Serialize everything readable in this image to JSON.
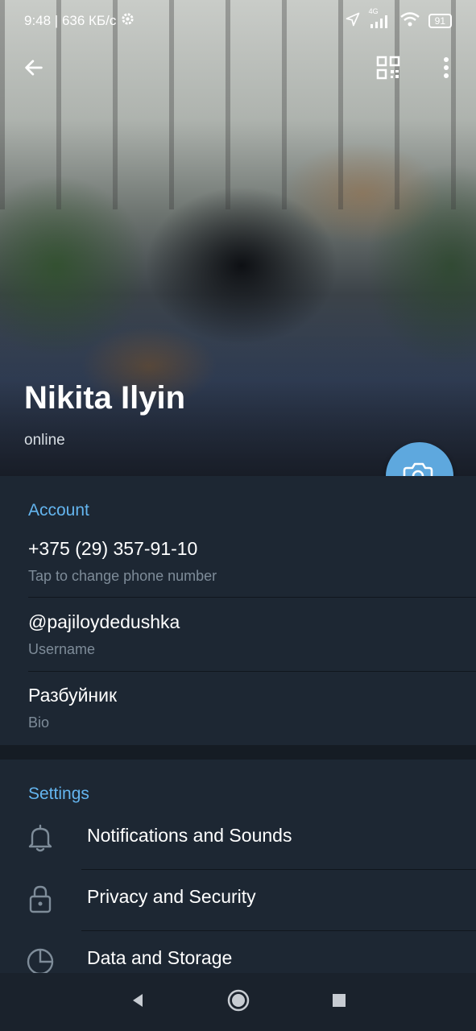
{
  "status_bar": {
    "time": "9:48 | 636 КБ/с",
    "network": "4G",
    "battery": "91"
  },
  "header": {
    "name": "Nikita Ilyin",
    "status": "online"
  },
  "account": {
    "title": "Account",
    "phone": "+375 (29) 357-91-10",
    "phone_hint": "Tap to change phone number",
    "username": "@pajiloydedushka",
    "username_label": "Username",
    "bio": "Разбуйник",
    "bio_label": "Bio"
  },
  "settings": {
    "title": "Settings",
    "items": [
      {
        "label": "Notifications and Sounds",
        "icon": "bell-icon"
      },
      {
        "label": "Privacy and Security",
        "icon": "lock-icon"
      },
      {
        "label": "Data and Storage",
        "icon": "pie-chart-icon"
      }
    ]
  },
  "colors": {
    "accent": "#64b5ef",
    "fab": "#5ea8de",
    "background": "#1d2733"
  }
}
